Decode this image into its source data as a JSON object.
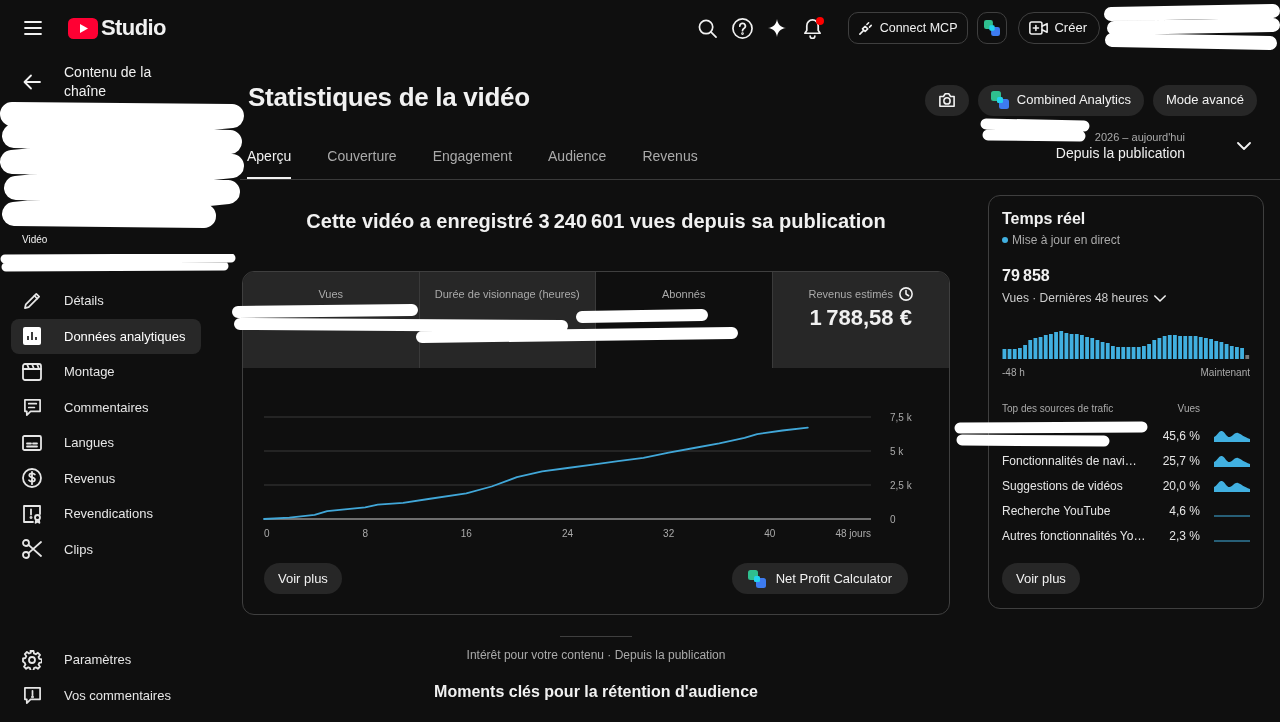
{
  "top_bar": {
    "logo_text": "Studio",
    "has_unread": true,
    "connect_button": "Connect MCP",
    "create_button": "Créer"
  },
  "sidebar": {
    "back_label": "Contenu de la chaîne",
    "video_label": "Vidéo",
    "items": [
      {
        "label": "Détails",
        "selected": false
      },
      {
        "label": "Données analytiques",
        "selected": true
      },
      {
        "label": "Montage",
        "selected": false
      },
      {
        "label": "Commentaires",
        "selected": false
      },
      {
        "label": "Langues",
        "selected": false
      },
      {
        "label": "Revenus",
        "selected": false
      },
      {
        "label": "Revendications",
        "selected": false
      },
      {
        "label": "Clips",
        "selected": false
      }
    ],
    "footer_items": [
      {
        "label": "Paramètres",
        "selected": false
      },
      {
        "label": "Vos commentaires",
        "selected": false
      }
    ]
  },
  "header": {
    "title": "Statistiques de la vidéo",
    "buttons": [
      {
        "label": "Combined Analytics",
        "kind": "extension"
      },
      {
        "label": "Mode avancé",
        "kind": "plain"
      }
    ],
    "tabs": [
      {
        "label": "Aperçu",
        "selected": true
      },
      {
        "label": "Couverture",
        "selected": false
      },
      {
        "label": "Engagement",
        "selected": false
      },
      {
        "label": "Audience",
        "selected": false
      },
      {
        "label": "Revenus",
        "selected": false
      }
    ],
    "date_range": {
      "range": "2026 – aujourd'hui",
      "period": "Depuis la publication"
    }
  },
  "overview": {
    "headline": "Cette vidéo a enregistré 3 240 601 vues depuis sa publication",
    "metrics": [
      {
        "label": "Vues",
        "selected": false,
        "clock_icon": false
      },
      {
        "label": "Durée de visionnage (heures)",
        "selected": false,
        "clock_icon": false
      },
      {
        "label": "Abonnés",
        "selected": true,
        "clock_icon": false
      },
      {
        "label": "Revenus estimés",
        "value": "1 788,58 €",
        "selected": false,
        "clock_icon": true
      }
    ],
    "chart_data": {
      "type": "line",
      "x": [
        0,
        2,
        4,
        5,
        8,
        9,
        11,
        13,
        16,
        18,
        20,
        22,
        24,
        26,
        28,
        30,
        32,
        34,
        36,
        38,
        39,
        41,
        43
      ],
      "values": [
        0,
        100,
        300,
        580,
        850,
        1060,
        1190,
        1470,
        1880,
        2390,
        3070,
        3510,
        3750,
        3990,
        4260,
        4500,
        4880,
        5220,
        5560,
        5970,
        6240,
        6510,
        6720
      ],
      "xlim": [
        0,
        48
      ],
      "ylim": [
        0,
        7500
      ],
      "xticks": [
        0,
        8,
        16,
        24,
        32,
        40,
        {
          "value": 48,
          "label": "48 jours"
        }
      ],
      "yticks": [
        0,
        {
          "value": 2500,
          "label": "2,5 k"
        },
        {
          "value": 5000,
          "label": "5 k"
        },
        {
          "value": 7500,
          "label": "7,5 k"
        }
      ]
    },
    "more_button": "Voir plus",
    "calculator_button": "Net Profit Calculator"
  },
  "realtime": {
    "title": "Temps réel",
    "status": "Mise à jour en direct",
    "count": "79 858",
    "metric": "Vues · Dernières 48 heures",
    "axis_start": "-48 h",
    "axis_end": "Maintenant",
    "sources_header": "Top des sources de trafic",
    "views_header": "Vues",
    "sources": [
      {
        "share": "45,6 %",
        "kind": "area"
      },
      {
        "source": "Fonctionnalités de navi…",
        "share": "25,7 %",
        "kind": "area"
      },
      {
        "source": "Suggestions de vidéos",
        "share": "20,0 %",
        "kind": "area"
      },
      {
        "source": "Recherche YouTube",
        "share": "4,6 %",
        "kind": "line"
      },
      {
        "source": "Autres fonctionnalités Yo…",
        "share": "2,3 %",
        "kind": "line"
      }
    ],
    "more_button": "Voir plus"
  },
  "footer": {
    "subtitle": "Intérêt pour votre contenu · Depuis la publication",
    "heading": "Moments clés pour la rétention d'audience"
  }
}
